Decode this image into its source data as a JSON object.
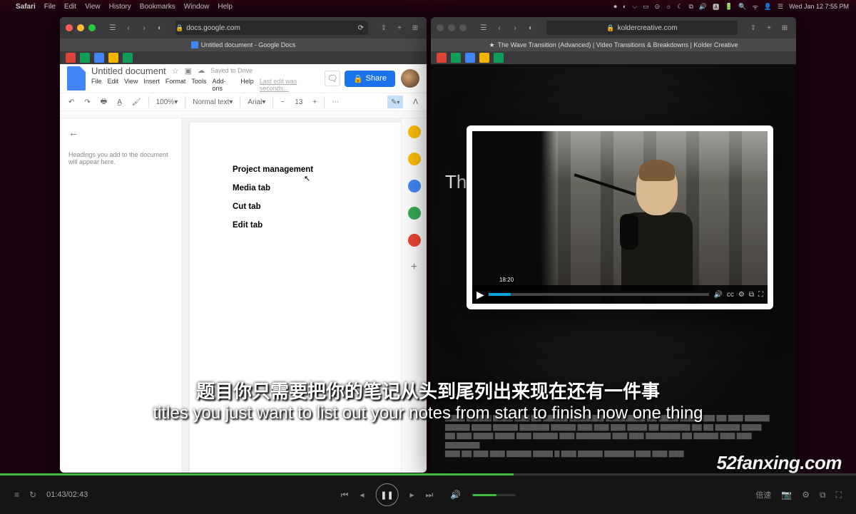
{
  "menubar": {
    "app": "Safari",
    "items": [
      "File",
      "Edit",
      "View",
      "History",
      "Bookmarks",
      "Window",
      "Help"
    ],
    "datetime": "Wed Jan 12  7:55 PM"
  },
  "left_window": {
    "url": "docs.google.com",
    "tab_title": "Untitled document - Google Docs",
    "doc_title": "Untitled document",
    "save_state": "Saved to Drive",
    "menus": [
      "File",
      "Edit",
      "View",
      "Insert",
      "Format",
      "Tools",
      "Add-ons",
      "Help"
    ],
    "last_edit": "Last edit was seconds...",
    "share_label": "Share",
    "toolbar": {
      "zoom": "100%",
      "style": "Normal text",
      "font": "Arial",
      "size": "13"
    },
    "outline_hint": "Headings you add to the document will appear here.",
    "content": [
      "Project management",
      "Media tab",
      "Cut tab",
      "Edit tab"
    ]
  },
  "right_window": {
    "url": "koldercreative.com",
    "tab_title": "The Wave Transition (Advanced) | Video Transitions & Breakdowns | Kolder Creative",
    "hero": "Th",
    "video_time": "18:20"
  },
  "subtitles": {
    "cn": "题目你只需要把你的笔记从头到尾列出来现在还有一件事",
    "en": "titles you just want to list out your notes from start to finish now one thing"
  },
  "player": {
    "time": "01:43/02:43",
    "progress_pct": 60,
    "speed": "倍速"
  },
  "watermark": "52fanxing.com"
}
